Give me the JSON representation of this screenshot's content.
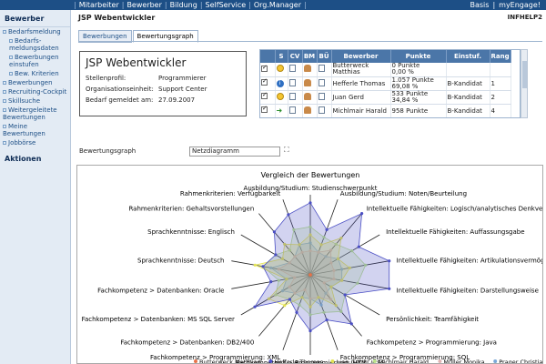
{
  "topbar": {
    "nav": [
      "Mitarbeiter",
      "Bewerber",
      "Bildung",
      "SelfService",
      "Org.Manager"
    ],
    "right": [
      "Basis",
      "myEngage!"
    ]
  },
  "sidebar": {
    "heading": "Bewerber",
    "items": [
      {
        "label": "Bedarfsmeldung",
        "sub": false
      },
      {
        "label": "Bedarfs-meldungsdaten",
        "sub": true
      },
      {
        "label": "Bewerbungen einstufen",
        "sub": true
      },
      {
        "label": "Bew. Kriterien",
        "sub": true
      },
      {
        "label": "Bewerbungen",
        "sub": false
      },
      {
        "label": "Recruiting-Cockpit",
        "sub": false
      },
      {
        "label": "Skillsuche",
        "sub": false
      },
      {
        "label": "Weitergeleitete Bewertungen",
        "sub": false
      },
      {
        "label": "Meine Bewertungen",
        "sub": false
      },
      {
        "label": "Jobbörse",
        "sub": false
      }
    ],
    "actions": "Aktionen"
  },
  "header": {
    "title": "JSP Webentwickler",
    "code": "INFHELP2"
  },
  "tabs": [
    "Bewerbungen",
    "Bewertungsgraph"
  ],
  "info": {
    "heading": "JSP Webentwickler",
    "rows": [
      {
        "label": "Stellenprofil:",
        "value": "Programmierer"
      },
      {
        "label": "Organisationseinheit:",
        "value": "Support Center"
      },
      {
        "label": "Bedarf gemeldet am:",
        "value": "27.09.2007"
      }
    ]
  },
  "table": {
    "columns": [
      "",
      "S",
      "CV",
      "BM",
      "BÜ",
      "Bewerber",
      "Punkte",
      "Einstuf.",
      "Rang"
    ],
    "rows": [
      {
        "name": "Butterweck Matthias",
        "punkte": "0 Punkte",
        "pct": "0,00 %",
        "einstuf": "",
        "rang": ""
      },
      {
        "name": "Hefferle Thomas",
        "punkte": "1.057 Punkte",
        "pct": "69,08 %",
        "einstuf": "B-Kandidat",
        "rang": "1"
      },
      {
        "name": "Juan Gerd",
        "punkte": "533 Punkte",
        "pct": "34,84 %",
        "einstuf": "B-Kandidat",
        "rang": "2"
      },
      {
        "name": "Michlmair Harald",
        "punkte": "958 Punkte",
        "pct": "",
        "einstuf": "B-Kandidat",
        "rang": "4"
      }
    ]
  },
  "graph_select": {
    "label": "Bewertungsgraph",
    "value": "Netzdiagramm"
  },
  "chart_data": {
    "type": "radar",
    "title": "Vergleich der Bewertungen",
    "axes": [
      "Ausbildung/Studium: Studienschwerpunkt",
      "Ausbildung/Studium: Noten/Beurteilung",
      "Intellektuelle Fähigkeiten: Logisch/analytisches Denkvermögen",
      "Intellektuelle Fähigkeiten: Auffassungsgabe",
      "Intellektuelle Fähigkeiten: Artikulationsvermögen",
      "Intellektuelle Fähigkeiten: Darstellungsweise",
      "Persönlichkeit: Teamfähigkeit",
      "Fachkompetenz > Programmierung: Java",
      "Fachkompetenz > Programmierung: SQL",
      "Fachkompetenz > Programmierung: HTML/CSS",
      "Fachkompetenz > Programmierung: XML",
      "Fachkompetenz > Datenbanken: DB2/400",
      "Fachkompetenz > Datenbanken: MS SQL Server",
      "Fachkompetenz > Datenbanken: Oracle",
      "Sprachkenntnisse: Deutsch",
      "Sprachkenntnisse: Englisch",
      "Rahmenkriterien: Gehaltsvorstellungen",
      "Rahmenkriterien: Verfügbarkeit"
    ],
    "series": [
      {
        "name": "Butterweck Matthias",
        "color": "#e8734a",
        "values": [
          0,
          0,
          0,
          0,
          0,
          0,
          0,
          0,
          0,
          0,
          0,
          0,
          0,
          0,
          0,
          0,
          0,
          0
        ]
      },
      {
        "name": "Hefferle Thomas",
        "color": "#4b4fc4",
        "values": [
          0.9,
          0.6,
          1.0,
          0.7,
          1.0,
          1.0,
          0.5,
          0.8,
          0.6,
          0.7,
          0.5,
          0.4,
          0.8,
          0.5,
          0.6,
          0.5,
          0.7,
          0.8
        ]
      },
      {
        "name": "Juan Gerd",
        "color": "#e3e354",
        "values": [
          0.5,
          0.4,
          0.6,
          0.4,
          0.5,
          0.4,
          0.3,
          0.5,
          0.3,
          0.4,
          0.3,
          0.5,
          0.6,
          0.3,
          0.7,
          0.4,
          0.5,
          0.4
        ]
      },
      {
        "name": "Michlmair Harald",
        "color": "#b9e08a",
        "values": [
          0.6,
          0.5,
          0.5,
          0.6,
          0.7,
          0.6,
          0.5,
          0.6,
          0.5,
          0.5,
          0.4,
          0.4,
          0.5,
          0.4,
          0.6,
          0.5,
          0.4,
          0.6
        ]
      },
      {
        "name": "Müller Monika",
        "color": "#e0b3b3",
        "values": [
          0.3,
          0.3,
          0.4,
          0.3,
          0.3,
          0.3,
          0.2,
          0.4,
          0.3,
          0.3,
          0.2,
          0.3,
          0.3,
          0.2,
          0.4,
          0.3,
          0.3,
          0.3
        ]
      },
      {
        "name": "Prager Christian",
        "color": "#7aa8d8",
        "values": [
          0.4,
          0.3,
          0.3,
          0.4,
          0.4,
          0.4,
          0.3,
          0.3,
          0.4,
          0.3,
          0.3,
          0.3,
          0.4,
          0.3,
          0.5,
          0.3,
          0.3,
          0.4
        ]
      }
    ]
  }
}
